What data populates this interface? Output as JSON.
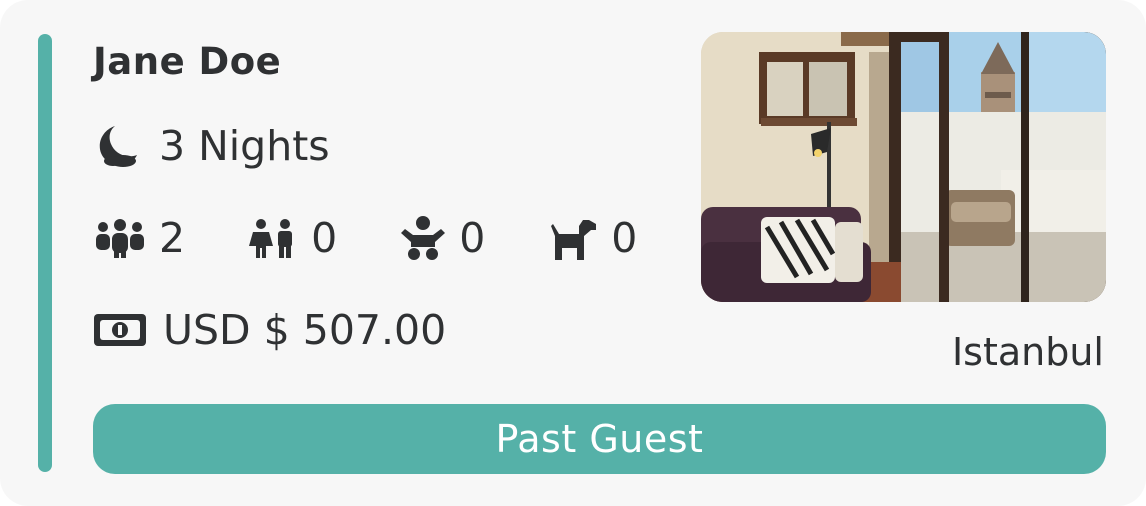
{
  "guest": {
    "name": "Jane Doe"
  },
  "stay": {
    "nights_label": "3 Nights"
  },
  "occupancy": {
    "adults": "2",
    "children": "0",
    "infants": "0",
    "pets": "0"
  },
  "price": {
    "label": "USD $ 507.00"
  },
  "listing": {
    "city": "Istanbul",
    "photo_icon": "apartment-balcony-photo"
  },
  "status": {
    "label": "Past Guest"
  },
  "icons": {
    "nights": "moon-icon",
    "adults": "adults-icon",
    "children": "children-icon",
    "infants": "infant-icon",
    "pets": "dog-icon",
    "price": "money-icon"
  },
  "colors": {
    "accent": "#55b1a8",
    "text": "#2f3133",
    "card": "#f7f7f7"
  }
}
